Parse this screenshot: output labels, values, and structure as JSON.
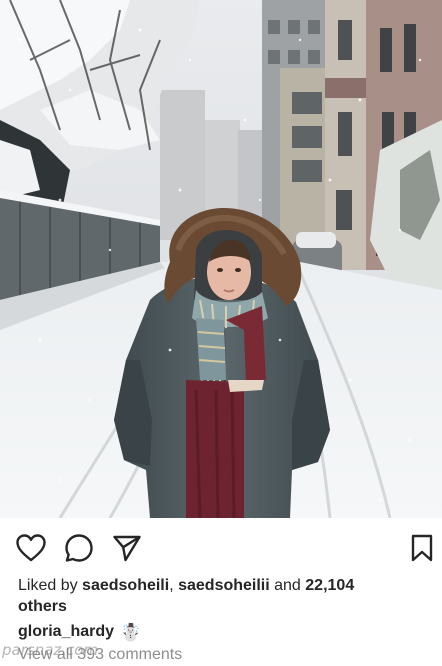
{
  "post": {
    "liked_by_prefix": "Liked by ",
    "liker_one": "saedsoheili",
    "separator": ", ",
    "liker_two": "saedsoheilii",
    "and_text": " and ",
    "like_count": "22,104",
    "others_text": "others",
    "username": "gloria_hardy",
    "caption_emoji": "☃️",
    "view_comments": "View all 393 comments"
  },
  "icons": {
    "like": "heart-icon",
    "comment": "speech-bubble-icon",
    "share": "paper-plane-icon",
    "save": "bookmark-icon"
  },
  "watermark": "parsnaz.com",
  "colors": {
    "text": "#262626",
    "secondary_text": "#8e8e8e",
    "coat": "#4f5a5e",
    "scarf": "#7a2a35",
    "fur_hood": "#6a4a33",
    "snow": "#f2f4f6"
  }
}
